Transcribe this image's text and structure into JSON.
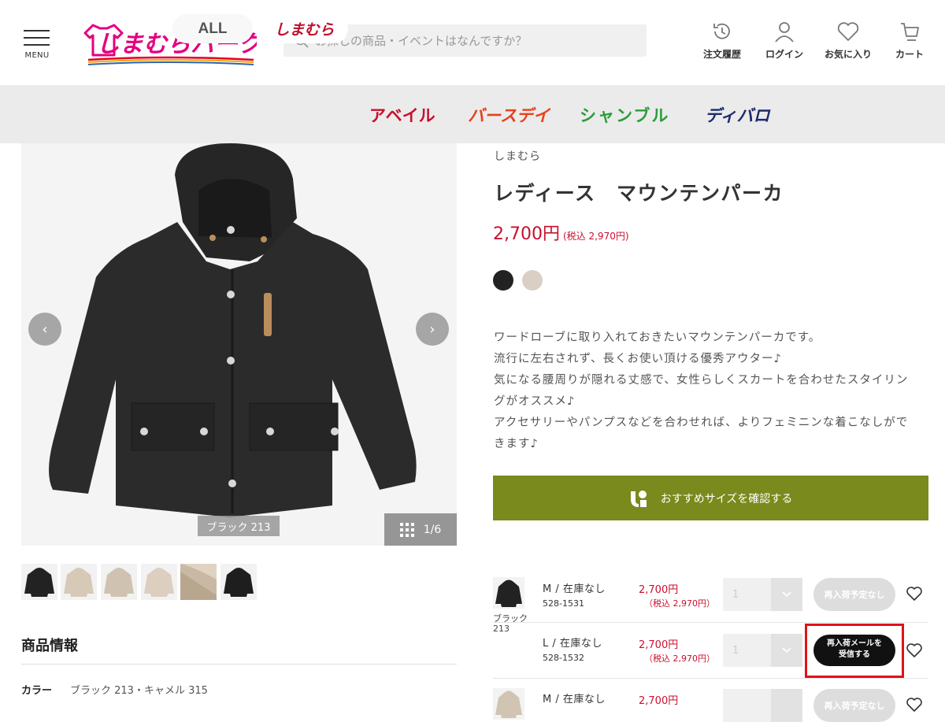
{
  "header": {
    "menu_label": "MENU",
    "logo_text": "しまむらパーク",
    "search_placeholder": "お探しの商品・イベントはなんですか？",
    "nav": [
      {
        "label": "注文履歴",
        "icon": "history-icon"
      },
      {
        "label": "ログイン",
        "icon": "user-icon"
      },
      {
        "label": "お気に入り",
        "icon": "heart-icon"
      },
      {
        "label": "カート",
        "icon": "cart-icon"
      }
    ]
  },
  "brand_tabs": [
    {
      "label": "ALL",
      "color": "#555555"
    },
    {
      "label": "しまむら",
      "color": "#c0102e"
    },
    {
      "label": "アベイル",
      "color": "#c8102e"
    },
    {
      "label": "バースデイ",
      "color": "#e8401c"
    },
    {
      "label": "シャンブル",
      "color": "#2a9d3a"
    },
    {
      "label": "ディバロ",
      "color": "#1d2a6e"
    }
  ],
  "gallery": {
    "color_tag": "ブラック 213",
    "counter": "1/6",
    "prev_icon": "chevron-left-icon",
    "next_icon": "chevron-right-icon"
  },
  "product": {
    "brand": "しまむら",
    "title": "レディース　マウンテンパーカ",
    "price": "2,700円",
    "price_tax": "(税込 2,970円)",
    "swatch_colors": [
      "#222222",
      "#d9cfc4"
    ],
    "description": [
      "ワードローブに取り入れておきたいマウンテンパーカです。",
      "流行に左右されず、長くお使い頂ける優秀アウター♪",
      "気になる腰周りが隠れる丈感で、女性らしくスカートを合わせたスタイリン",
      "グがオススメ♪",
      "アクセサリーやパンプスなどを合わせれば、よりフェミニンな着こなしがで",
      "きます♪"
    ],
    "size_button": "おすすめサイズを確認する"
  },
  "info": {
    "section_title": "商品情報",
    "color_key": "カラー",
    "color_value": "ブラック 213・キャメル 315"
  },
  "skus": [
    {
      "color": "ブラック",
      "color_code": "213",
      "size": "M / 在庫なし",
      "code": "528-1531",
      "price": "2,700円",
      "tax": "（税込 2,970円）",
      "qty": "1",
      "action": "再入荷予定なし"
    },
    {
      "size": "L / 在庫なし",
      "code": "528-1532",
      "price": "2,700円",
      "tax": "（税込 2,970円）",
      "qty": "1",
      "action_line1": "再入荷メールを",
      "action_line2": "受信する"
    },
    {
      "size": "M / 在庫なし",
      "price": "2,700円",
      "action": "再入荷予定なし"
    }
  ]
}
